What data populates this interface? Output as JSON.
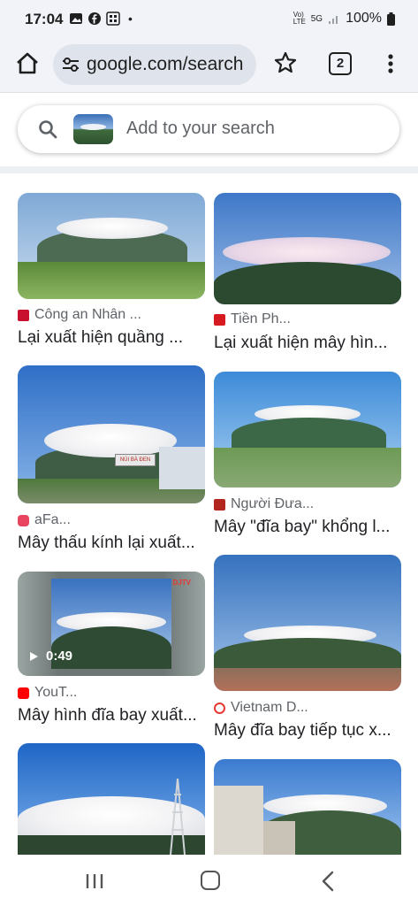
{
  "status_bar": {
    "time": "17:04",
    "dot": "•",
    "network": "5G",
    "lte": "Vo) LTE",
    "battery": "100%"
  },
  "url_bar": {
    "url": "google.com/search",
    "tab_count": "2"
  },
  "search": {
    "placeholder": "Add to your search"
  },
  "results": [
    {
      "source": "Công an Nhân ...",
      "title": "Lại xuất hiện quầng ...",
      "favicon_color": "#c8102e"
    },
    {
      "source": "Tiền Ph...",
      "title": "Lại xuất hiện mây hìn...",
      "favicon_color": "#d71920"
    },
    {
      "source": "aFa...",
      "title": "Mây thấu kính lại xuất...",
      "favicon_color": "#e94560"
    },
    {
      "source": "Người Đưa...",
      "title": "Mây \"đĩa bay\" khổng l...",
      "favicon_color": "#b3261e"
    },
    {
      "source": "YouT...",
      "title": "Mây hình đĩa bay xuất...",
      "favicon_color": "#ff0000",
      "video_duration": "0:49",
      "watermark": "DJTV"
    },
    {
      "source": "Vietnam D...",
      "title": "Mây đĩa bay tiếp tục x...",
      "favicon_color": "#e53935"
    }
  ],
  "sign_text": "NÚI BÀ ĐEN"
}
